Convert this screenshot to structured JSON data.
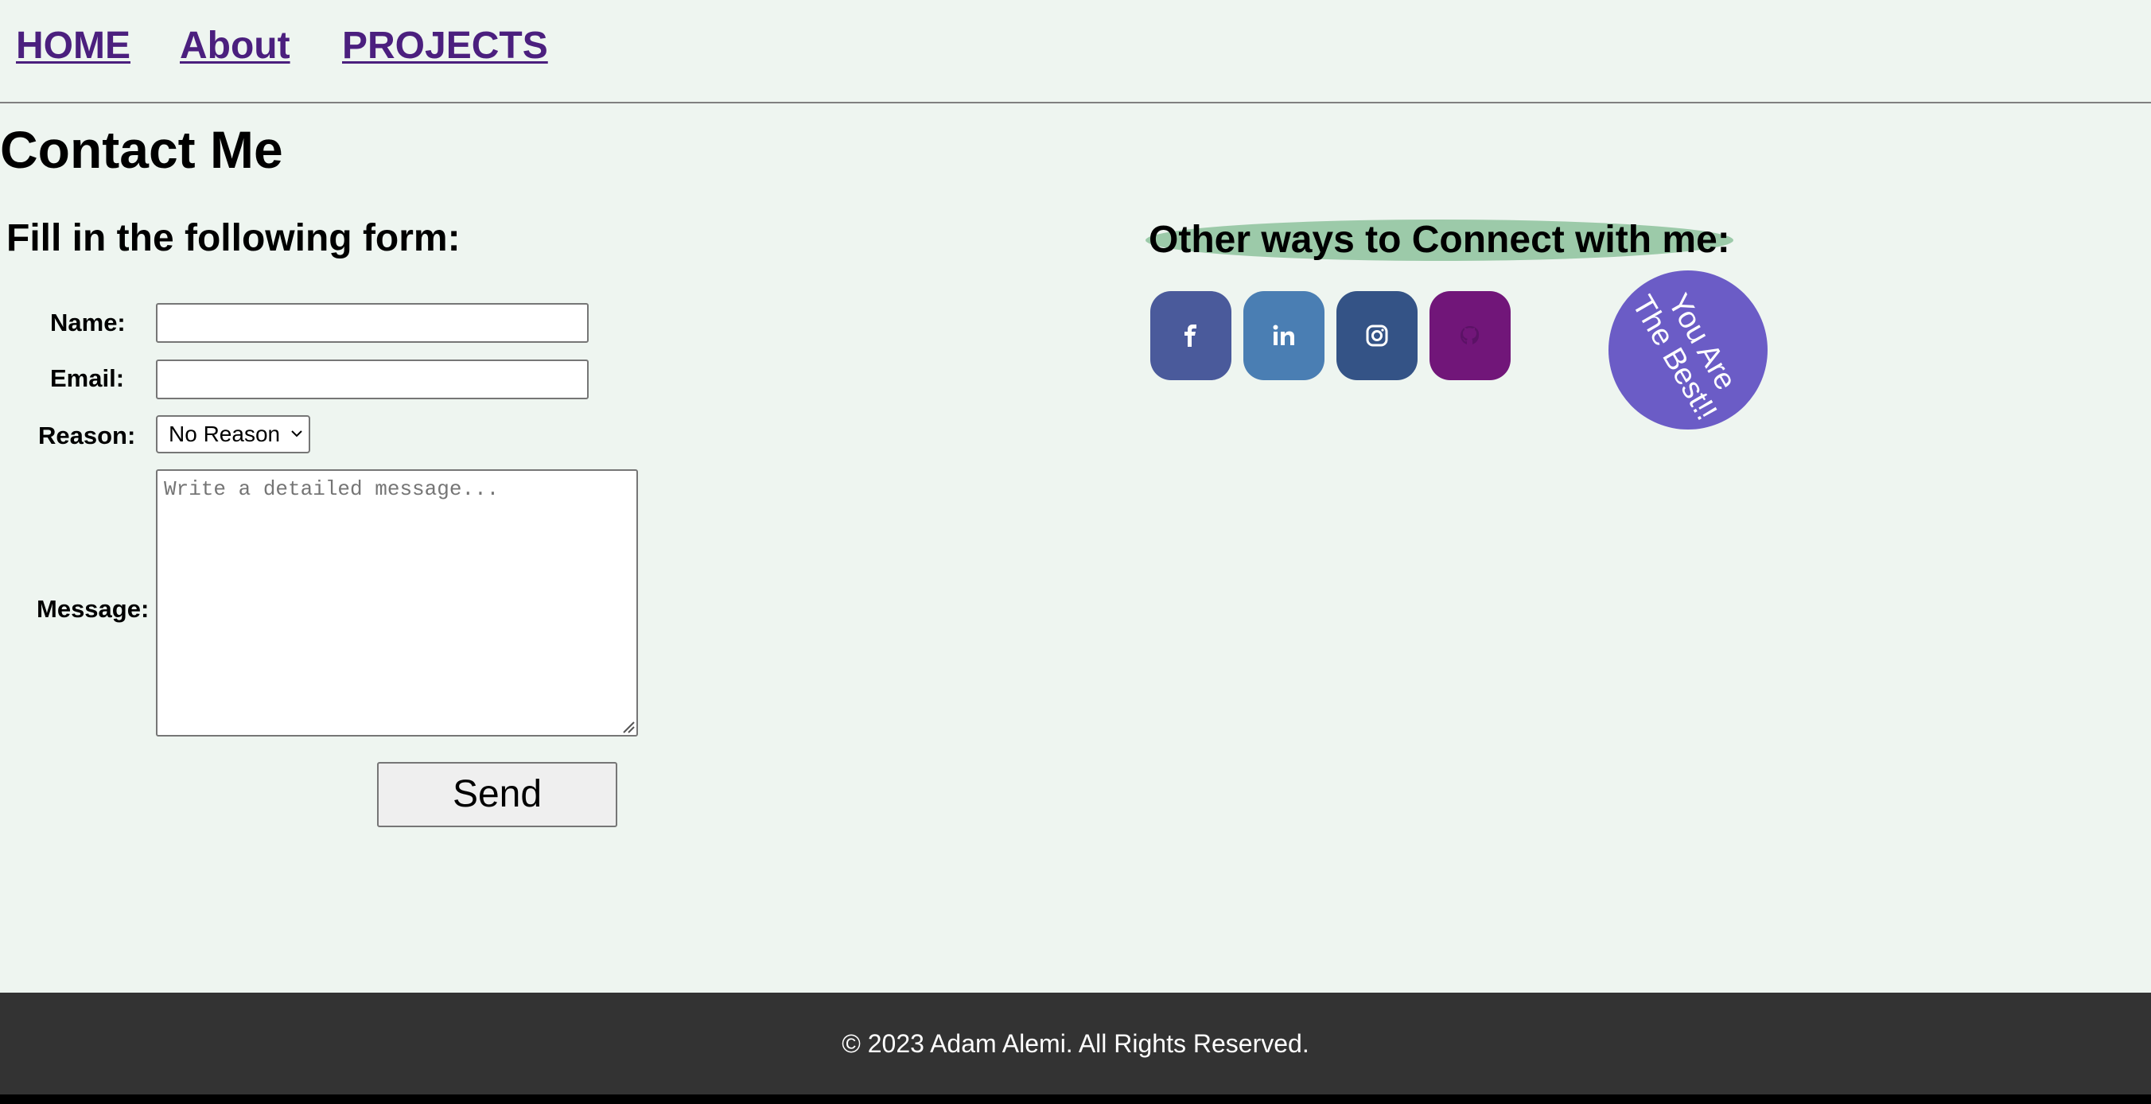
{
  "nav": {
    "home": "HOME",
    "about": "About",
    "projects": "PROJECTS"
  },
  "page": {
    "title": "Contact Me"
  },
  "form": {
    "heading": "Fill in the following form:",
    "name_label": "Name:",
    "name_value": "",
    "email_label": "Email:",
    "email_value": "",
    "reason_label": "Reason:",
    "reason_selected": "No Reason",
    "message_label": "Message:",
    "message_placeholder": "Write a detailed message...",
    "send_label": "Send"
  },
  "connect": {
    "heading": "Other ways to Connect with me:",
    "icons": [
      {
        "name": "facebook-icon",
        "color": "#4a5a9b"
      },
      {
        "name": "linkedin-icon",
        "color": "#4a7eb3"
      },
      {
        "name": "instagram-icon",
        "color": "#345386"
      },
      {
        "name": "github-icon",
        "color": "#711679"
      }
    ],
    "badge_line1": "You Are",
    "badge_line2": "The Best!!",
    "badge_color": "#6b5cc6"
  },
  "footer": {
    "text": "© 2023 Adam Alemi. All Rights Reserved."
  },
  "colors": {
    "background": "#eef5f0",
    "nav_link": "#4b1f7e",
    "footer_bg": "#333333",
    "connect_highlight": "#9ccaa9"
  }
}
